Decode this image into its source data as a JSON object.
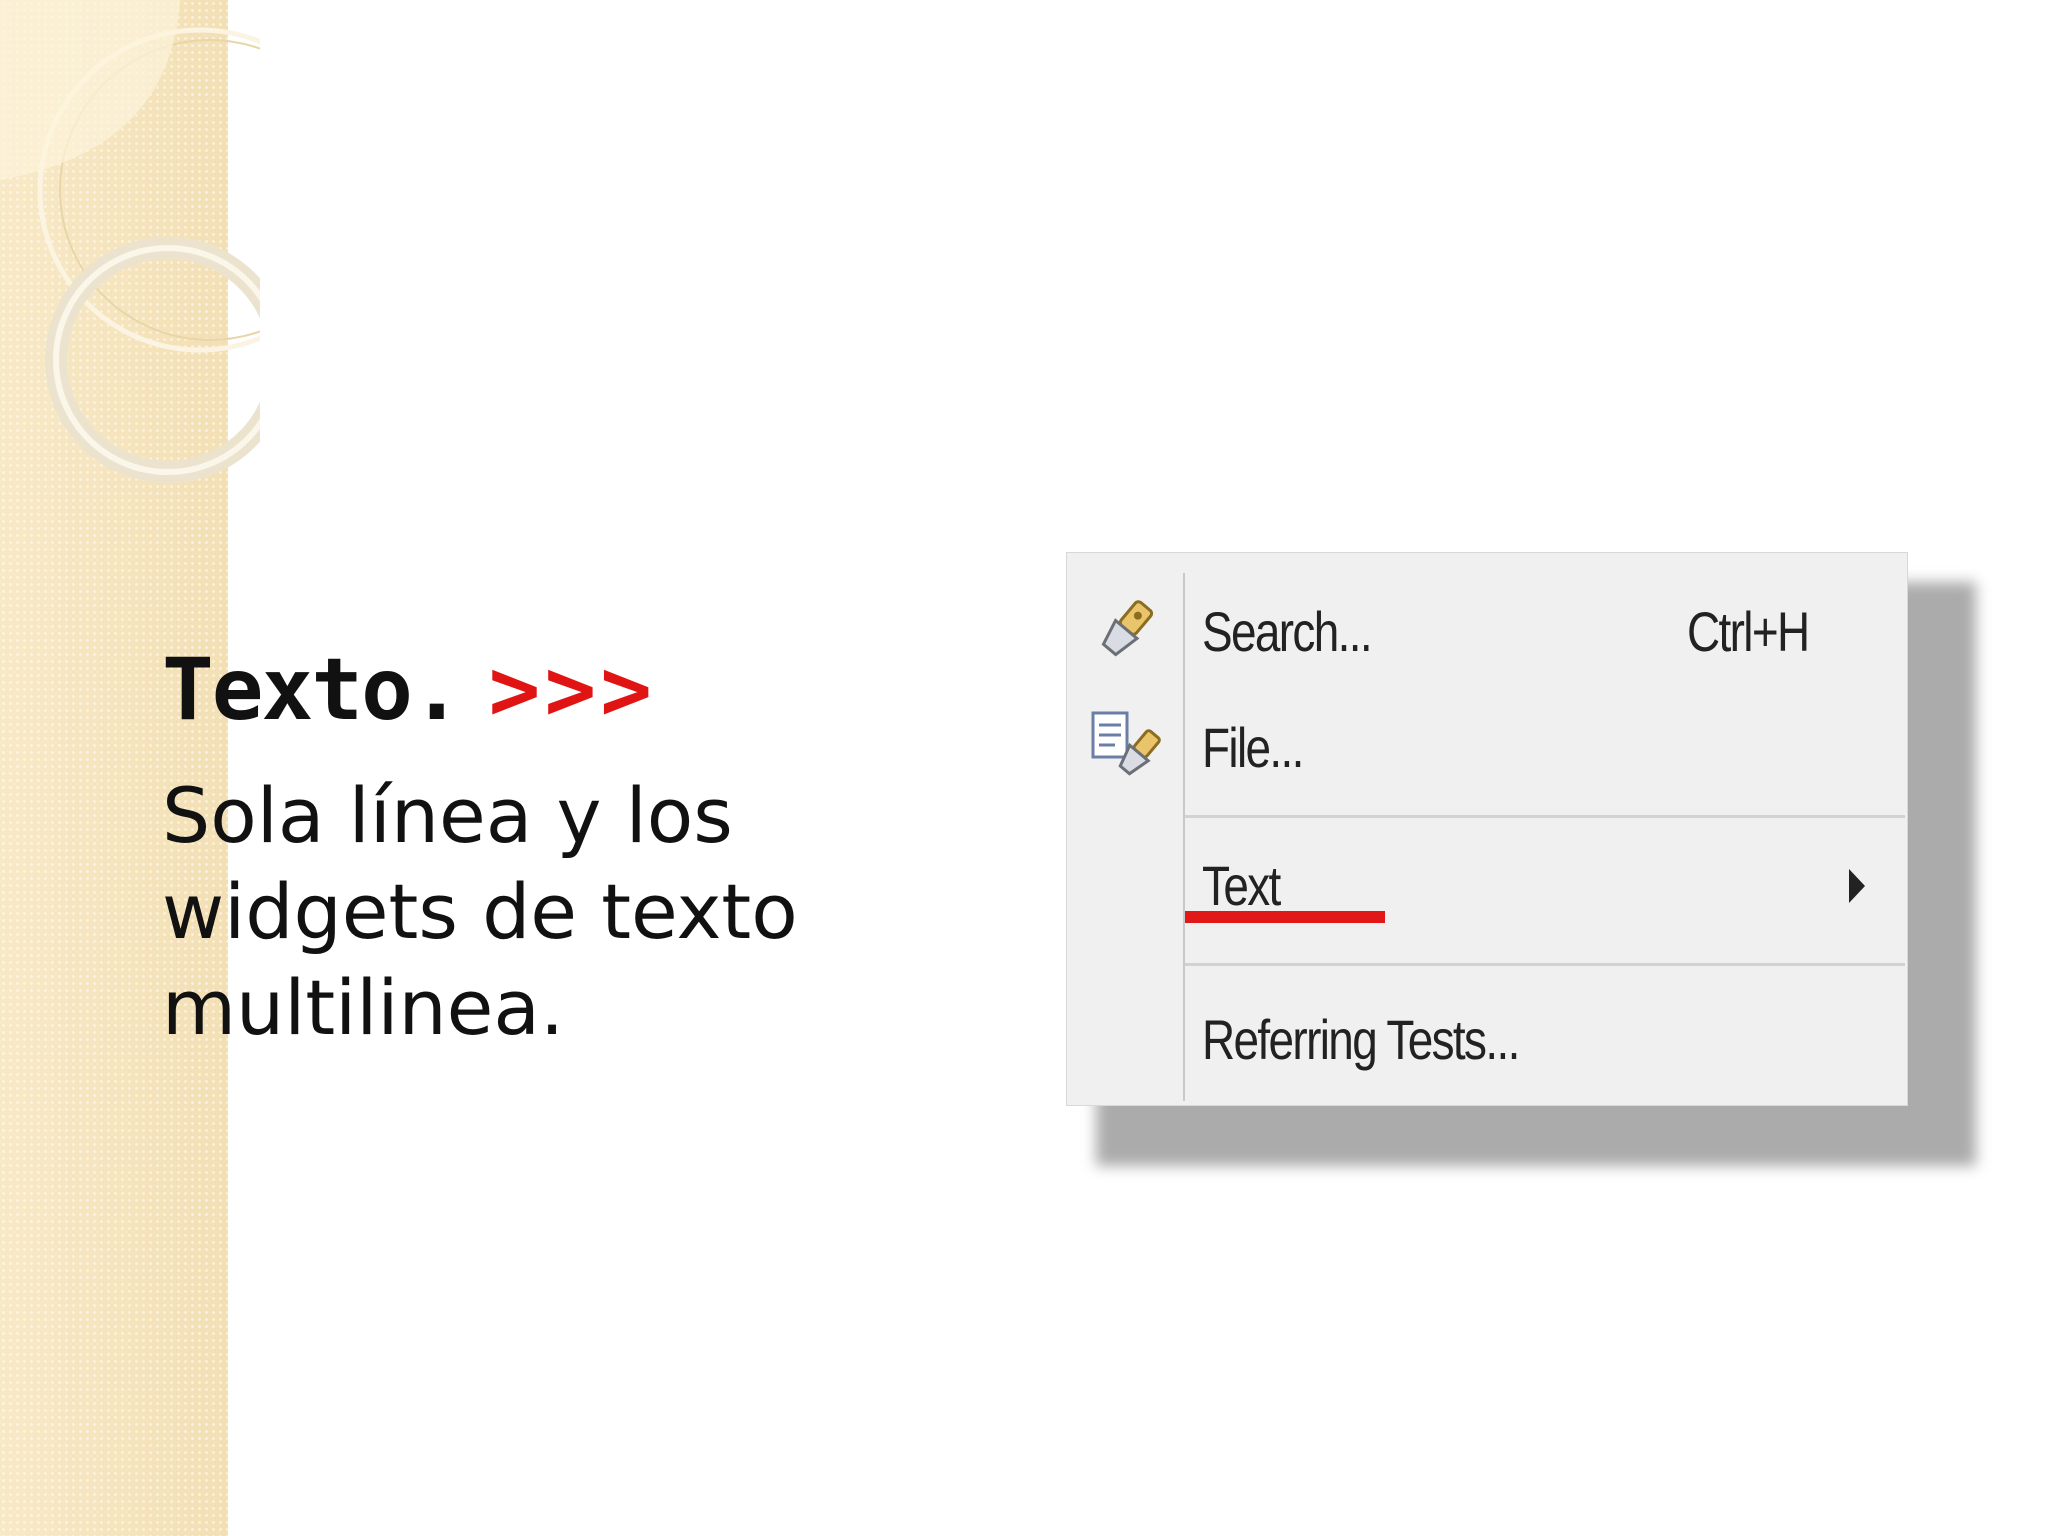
{
  "slide": {
    "title": "Texto.",
    "title_arrows": ">>>",
    "body": "Sola línea y los widgets de texto multilinea."
  },
  "menu": {
    "items": [
      {
        "label": "Search...",
        "shortcut": "Ctrl+H",
        "icon": "search-flashlight-icon"
      },
      {
        "label": "File...",
        "shortcut": "",
        "icon": "file-search-icon"
      },
      {
        "label": "Text",
        "shortcut": "",
        "has_submenu": true
      },
      {
        "label": "Referring Tests...",
        "shortcut": ""
      }
    ],
    "highlight_color": "#e01818"
  },
  "colors": {
    "sidebar": "#f6e6c1",
    "arrows": "#e11414",
    "menu_background": "#f0f0f0"
  }
}
